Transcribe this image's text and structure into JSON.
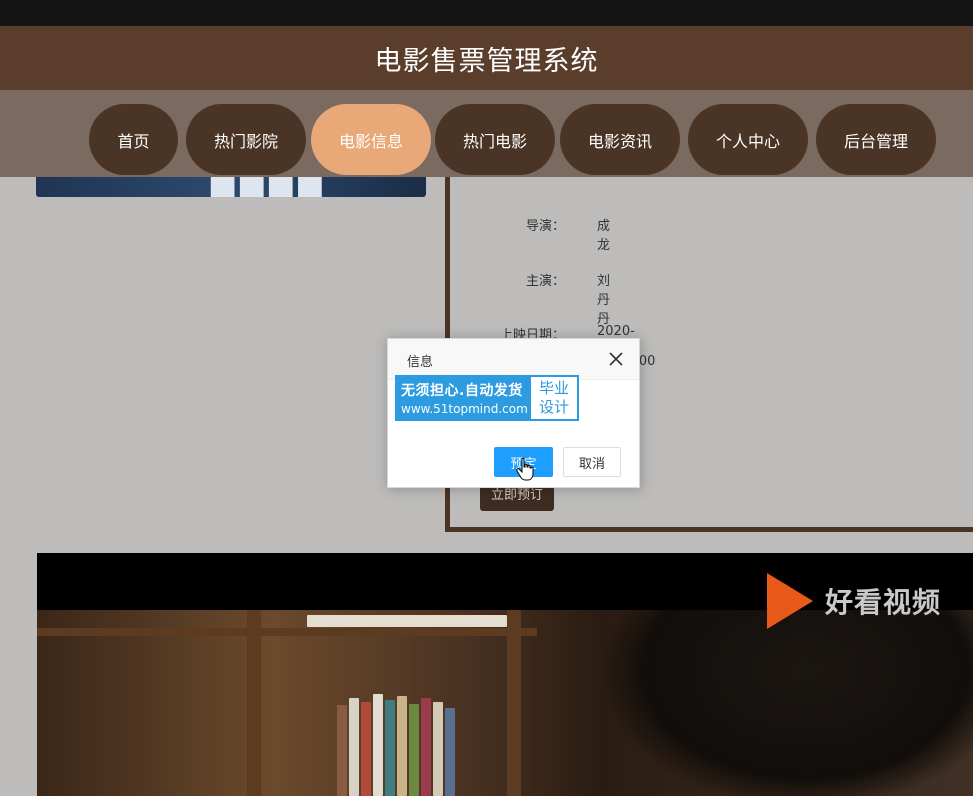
{
  "header": {
    "title": "电影售票管理系统"
  },
  "nav": {
    "items": [
      {
        "label": "首页",
        "active": false
      },
      {
        "label": "热门影院",
        "active": false
      },
      {
        "label": "电影信息",
        "active": true
      },
      {
        "label": "热门电影",
        "active": false
      },
      {
        "label": "电影资讯",
        "active": false
      },
      {
        "label": "个人中心",
        "active": false
      },
      {
        "label": "后台管理",
        "active": false
      }
    ]
  },
  "movie": {
    "fields": [
      {
        "label": "导演：",
        "value": "成龙"
      },
      {
        "label": "主演：",
        "value": "刘丹丹"
      },
      {
        "label": "上映日期：",
        "value": "2020-12-07 00:00:00"
      }
    ],
    "book_button": "立即预订"
  },
  "video": {
    "logo_text": "好看视频"
  },
  "dialog": {
    "title": "信息",
    "watermark": {
      "line1": "无须担心.自动发货",
      "line2": "www.51topmind.com",
      "right_line1": "毕业",
      "right_line2": "设计"
    },
    "ok_label": "预定",
    "cancel_label": "取消"
  },
  "colors": {
    "header_bg": "#5a3e2b",
    "nav_item_bg": "#4a3425",
    "nav_active_bg": "#e8a877",
    "ok_button": "#1e9fff"
  }
}
